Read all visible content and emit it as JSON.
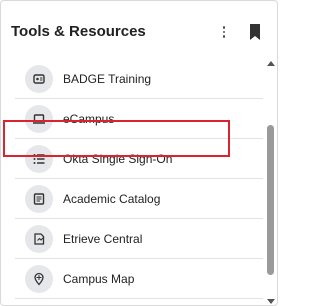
{
  "widget": {
    "title": "Tools & Resources"
  },
  "items": [
    {
      "label": "BADGE Training",
      "icon": "badge-icon"
    },
    {
      "label": "eCampus",
      "icon": "laptop-icon"
    },
    {
      "label": "Okta Single Sign-On",
      "icon": "list-icon"
    },
    {
      "label": "Academic Catalog",
      "icon": "catalog-icon"
    },
    {
      "label": "Etrieve Central",
      "icon": "document-icon"
    },
    {
      "label": "Campus Map",
      "icon": "map-icon"
    }
  ],
  "colors": {
    "highlight": "#d9232e",
    "icon_bg": "#e6e7ea"
  }
}
